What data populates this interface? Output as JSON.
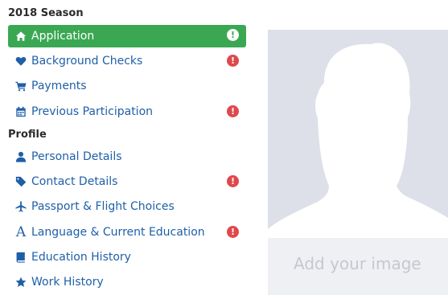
{
  "sidebar": {
    "section_season": "2018 Season",
    "section_profile": "Profile",
    "items": [
      {
        "label": "Application",
        "icon": "home-icon",
        "alert": "!",
        "active": true
      },
      {
        "label": "Background Checks",
        "icon": "heart-icon",
        "alert": "!"
      },
      {
        "label": "Payments",
        "icon": "cart-icon"
      },
      {
        "label": "Previous Participation",
        "icon": "calendar-icon",
        "alert": "!"
      },
      {
        "label": "Personal Details",
        "icon": "user-icon"
      },
      {
        "label": "Contact Details",
        "icon": "tag-icon",
        "alert": "!"
      },
      {
        "label": "Passport & Flight Choices",
        "icon": "plane-icon"
      },
      {
        "label": "Language & Current Education",
        "icon": "font-icon",
        "glyph": "A",
        "alert": "!"
      },
      {
        "label": "Education History",
        "icon": "book-icon"
      },
      {
        "label": "Work History",
        "icon": "star-icon"
      }
    ]
  },
  "photo": {
    "add_label": "Add your image",
    "icon": "user-silhouette-icon"
  },
  "colors": {
    "active": "#3aa853",
    "link": "#1f5fa8",
    "alert": "#e0484c",
    "panel": "#dde0e8"
  }
}
